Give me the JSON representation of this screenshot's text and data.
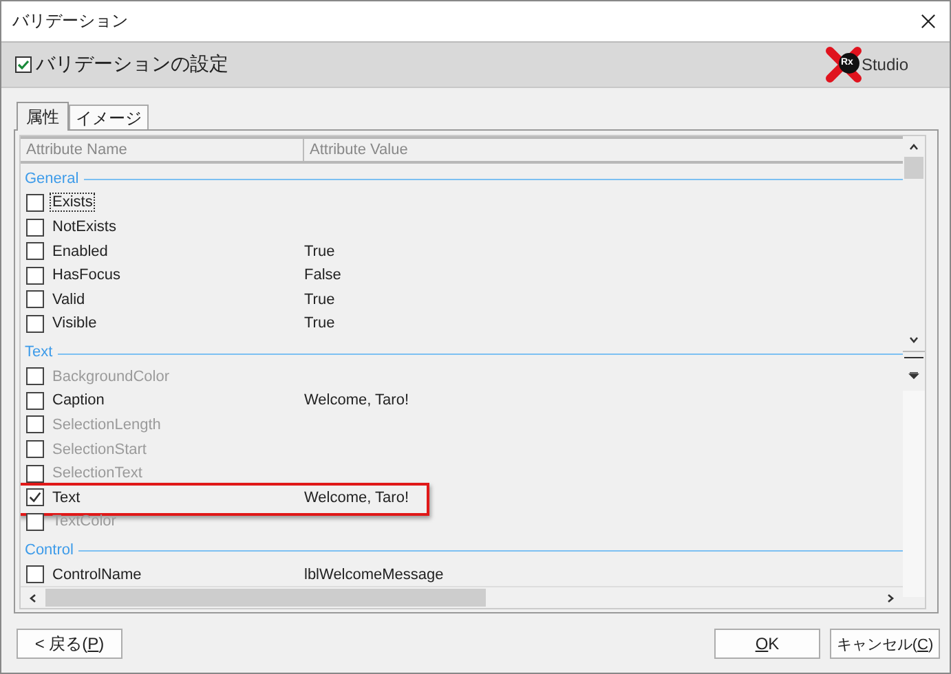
{
  "window": {
    "title": "バリデーション"
  },
  "header": {
    "title": "バリデーションの設定",
    "logo": {
      "mark": "Rx",
      "name": "Studio"
    }
  },
  "tabs": [
    {
      "label": "属性",
      "selected": true
    },
    {
      "label": "イメージ",
      "selected": false
    }
  ],
  "table": {
    "columns": [
      "Attribute Name",
      "Attribute Value"
    ],
    "groups": [
      {
        "name": "General",
        "rows": [
          {
            "name": "Exists",
            "checked": false,
            "disabled": false,
            "focused": true,
            "highlighted": false
          },
          {
            "name": "NotExists",
            "checked": false,
            "disabled": false,
            "focused": false,
            "highlighted": false
          },
          {
            "name": "Enabled",
            "value": "True",
            "checked": false,
            "disabled": false,
            "focused": false,
            "highlighted": false
          },
          {
            "name": "HasFocus",
            "value": "False",
            "checked": false,
            "disabled": false,
            "focused": false,
            "highlighted": false
          },
          {
            "name": "Valid",
            "value": "True",
            "checked": false,
            "disabled": false,
            "focused": false,
            "highlighted": false
          },
          {
            "name": "Visible",
            "value": "True",
            "checked": false,
            "disabled": false,
            "focused": false,
            "highlighted": false
          }
        ]
      },
      {
        "name": "Text",
        "rows": [
          {
            "name": "BackgroundColor",
            "checked": false,
            "disabled": true,
            "focused": false,
            "highlighted": false
          },
          {
            "name": "Caption",
            "value": "Welcome, Taro!",
            "checked": false,
            "disabled": false,
            "focused": false,
            "highlighted": false
          },
          {
            "name": "SelectionLength",
            "checked": false,
            "disabled": true,
            "focused": false,
            "highlighted": false
          },
          {
            "name": "SelectionStart",
            "checked": false,
            "disabled": true,
            "focused": false,
            "highlighted": false
          },
          {
            "name": "SelectionText",
            "checked": false,
            "disabled": true,
            "focused": false,
            "highlighted": false
          },
          {
            "name": "Text",
            "value": "Welcome, Taro!",
            "checked": true,
            "disabled": false,
            "focused": false,
            "highlighted": true
          },
          {
            "name": "TextColor",
            "checked": false,
            "disabled": true,
            "focused": false,
            "highlighted": false
          }
        ]
      },
      {
        "name": "Control",
        "rows": [
          {
            "name": "ControlName",
            "value": "lblWelcomeMessage",
            "checked": false,
            "disabled": false,
            "focused": false,
            "highlighted": false
          }
        ]
      }
    ]
  },
  "buttons": [
    {
      "kind": "back",
      "before": "< 戻る(",
      "mnemonic": "P",
      "after": ")"
    },
    {
      "kind": "ok",
      "mnemonic": "O",
      "after": "K"
    },
    {
      "kind": "cancel",
      "before": "キャンセル(",
      "mnemonic": "C",
      "after": ")"
    }
  ]
}
